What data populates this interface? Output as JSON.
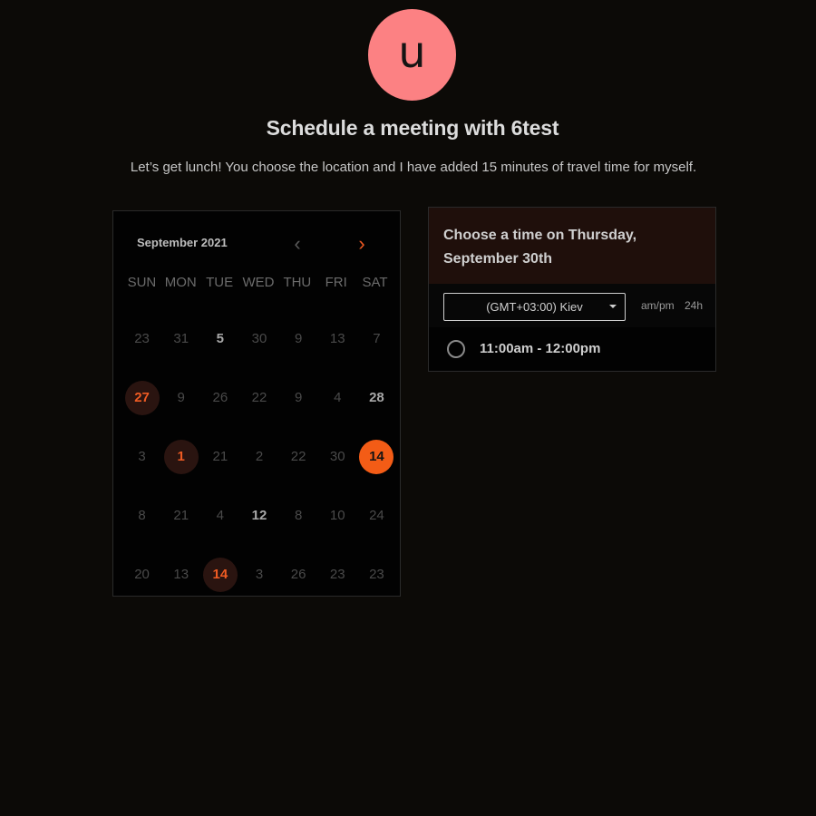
{
  "avatar": {
    "letter": "u",
    "color": "#fc8183"
  },
  "header": {
    "title": "Schedule a meeting with 6test",
    "subtitle": "Let’s get lunch! You choose the location and I have added 15 minutes of travel time for myself."
  },
  "calendar": {
    "month_label": "September 2021",
    "prev_icon": "chevron-left-icon",
    "next_icon": "chevron-right-icon",
    "accent": "#f35c16",
    "weekdays": [
      "SUN",
      "MON",
      "TUE",
      "WED",
      "THU",
      "FRI",
      "SAT"
    ],
    "days": [
      {
        "n": "23",
        "s": "dim"
      },
      {
        "n": "31",
        "s": "dim"
      },
      {
        "n": "5",
        "s": "bright"
      },
      {
        "n": "30",
        "s": "dim"
      },
      {
        "n": "9",
        "s": "dim"
      },
      {
        "n": "13",
        "s": "dim"
      },
      {
        "n": "7",
        "s": "dim"
      },
      {
        "n": "27",
        "s": "avail"
      },
      {
        "n": "9",
        "s": "dim"
      },
      {
        "n": "26",
        "s": "dim"
      },
      {
        "n": "22",
        "s": "dim"
      },
      {
        "n": "9",
        "s": "dim"
      },
      {
        "n": "4",
        "s": "dim"
      },
      {
        "n": "28",
        "s": "bright"
      },
      {
        "n": "3",
        "s": "dim"
      },
      {
        "n": "1",
        "s": "avail"
      },
      {
        "n": "21",
        "s": "dim"
      },
      {
        "n": "2",
        "s": "dim"
      },
      {
        "n": "22",
        "s": "dim"
      },
      {
        "n": "30",
        "s": "dim"
      },
      {
        "n": "14",
        "s": "selected"
      },
      {
        "n": "8",
        "s": "dim"
      },
      {
        "n": "21",
        "s": "dim"
      },
      {
        "n": "4",
        "s": "dim"
      },
      {
        "n": "12",
        "s": "bright"
      },
      {
        "n": "8",
        "s": "dim"
      },
      {
        "n": "10",
        "s": "dim"
      },
      {
        "n": "24",
        "s": "dim"
      },
      {
        "n": "20",
        "s": "dim"
      },
      {
        "n": "13",
        "s": "dim"
      },
      {
        "n": "14",
        "s": "avail"
      },
      {
        "n": "3",
        "s": "dim"
      },
      {
        "n": "26",
        "s": "dim"
      },
      {
        "n": "23",
        "s": "dim"
      },
      {
        "n": "23",
        "s": "dim"
      }
    ]
  },
  "time_panel": {
    "heading": "Choose a time on Thursday, September 30th",
    "timezone": "(GMT+03:00) Kiev",
    "format_ampm": "am/pm",
    "format_24h": "24h",
    "slots": [
      "11:00am - 12:00pm"
    ]
  }
}
